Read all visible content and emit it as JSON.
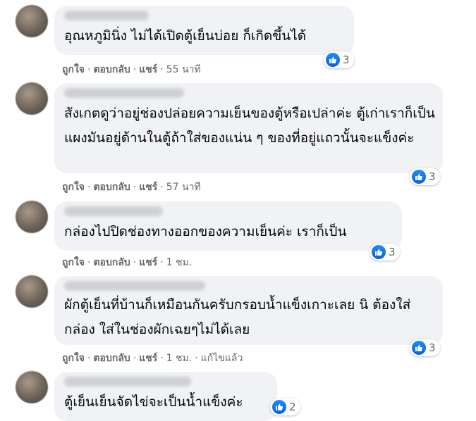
{
  "comments": [
    {
      "text": "อุณหภูมินิ่ง ไม่ได้เปิดตู้เย็นบ่อย ก็เกิดขึ้นได้",
      "reactions": "3",
      "like": "ถูกใจ",
      "reply": "ตอบกลับ",
      "share": "แชร์",
      "time": "55 นาที"
    },
    {
      "text": "สังเกตดูว่าอยู่ช่องปล่อยความเย็นของตู้หรือเปล่าค่ะ ตู้เก่าเราก็เป็นแผงมันอยู่ด้านในตู้ถ้าใส่ของแน่น ๆ ของที่อยู่แถวนั้นจะแข็งค่ะ",
      "reactions": "3",
      "like": "ถูกใจ",
      "reply": "ตอบกลับ",
      "share": "แชร์",
      "time": "57 นาที"
    },
    {
      "text": "กล่องไปปิดช่องทางออกของความเย็นค่ะ เราก็เป็น",
      "reactions": "3",
      "like": "ถูกใจ",
      "reply": "ตอบกลับ",
      "share": "แชร์",
      "time": "1 ชม."
    },
    {
      "text": "ผักตู้เย็นที่บ้านก็เหมือนกันครับกรอบน้ำแข็งเกาะเลย นิ ต้องใส่กล่อง ใส่ในช่องผักเฉยๆไม่ได้เลย",
      "reactions": "3",
      "like": "ถูกใจ",
      "reply": "ตอบกลับ",
      "share": "แชร์",
      "time": "1 ชม.",
      "edited": "แก้ไขแล้ว"
    },
    {
      "text": "ตู้เย็นเย็นจัดไข่จะเป็นน้ำแข็งค่ะ",
      "reactions": "2"
    }
  ],
  "colors": {
    "bubble": "#f0f2f5",
    "meta": "#65676b",
    "like_blue": "#1877f2"
  },
  "icons": {
    "reaction": "thumbs-up-icon"
  }
}
